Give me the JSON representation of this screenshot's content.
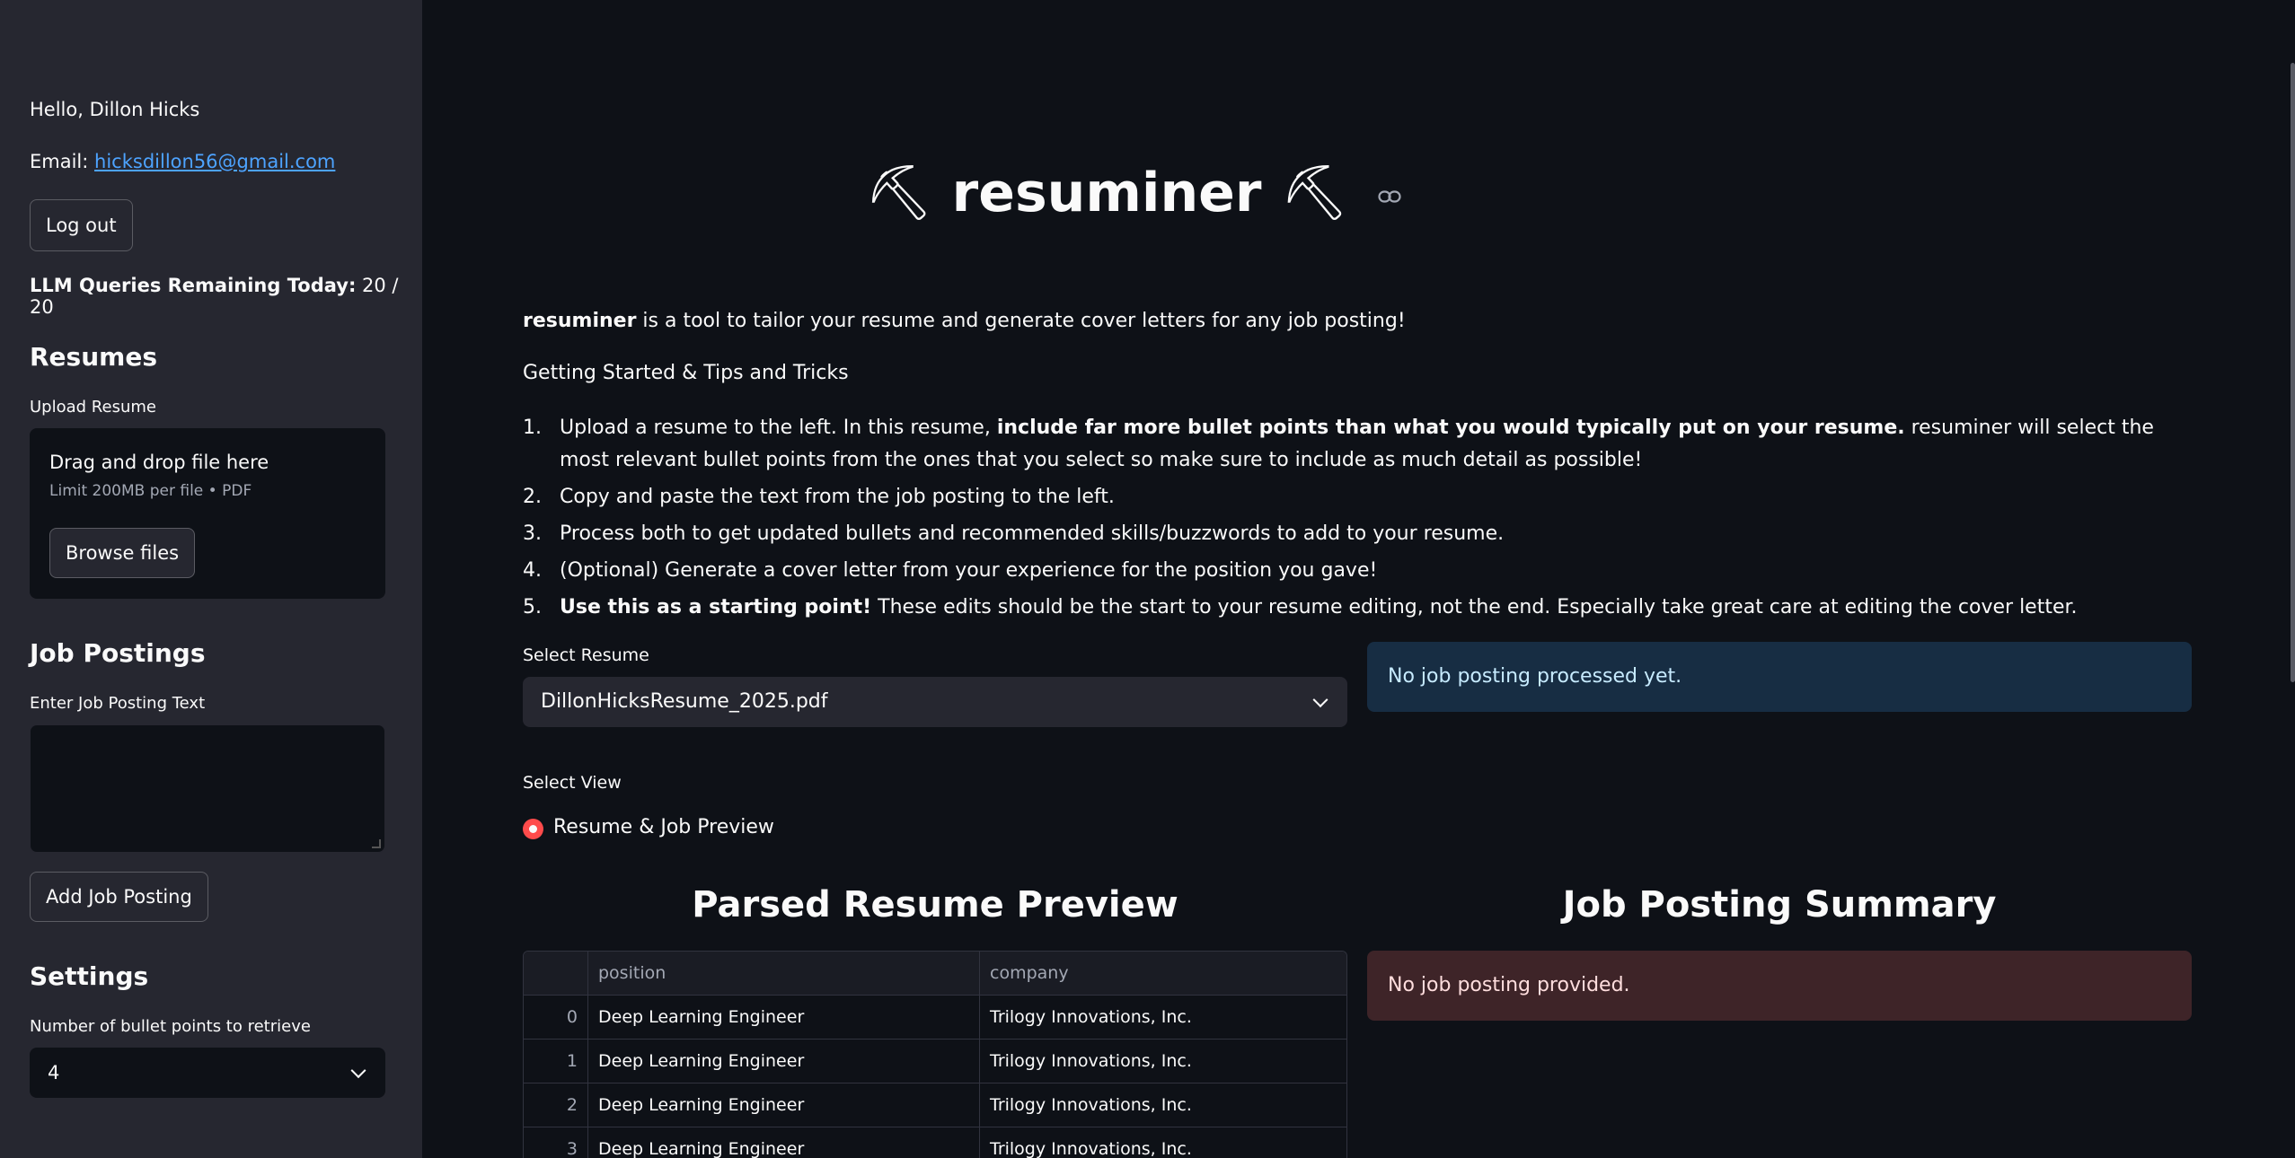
{
  "sidebar": {
    "greeting": "Hello, Dillon Hicks",
    "email_label": "Email:",
    "email_value": "hicksdillon56@gmail.com",
    "logout_label": "Log out",
    "queries_label": "LLM Queries Remaining Today:",
    "queries_value": "20 / 20",
    "resumes_heading": "Resumes",
    "upload_label": "Upload Resume",
    "upload_drop_text": "Drag and drop file here",
    "upload_limit": "Limit 200MB per file • PDF",
    "browse_label": "Browse files",
    "job_postings_heading": "Job Postings",
    "job_text_label": "Enter Job Posting Text",
    "job_text_value": "",
    "add_job_label": "Add Job Posting",
    "settings_heading": "Settings",
    "bullets_label": "Number of bullet points to retrieve",
    "bullets_value": "4"
  },
  "main": {
    "title": "resuminer",
    "title_icon": "⛏",
    "intro_bold": "resuminer",
    "intro_rest": " is a tool to tailor your resume and generate cover letters for any job posting!",
    "getting_started": "Getting Started & Tips and Tricks",
    "steps": [
      {
        "num": "1.",
        "pre": "Upload a resume to the left. In this resume, ",
        "bold": "include far more bullet points than what you would typically put on your resume.",
        "post": " resuminer will select the most relevant bullet points from the ones that you select so make sure to include as much detail as possible!"
      },
      {
        "num": "2.",
        "pre": "Copy and paste the text from the job posting to the left.",
        "bold": "",
        "post": ""
      },
      {
        "num": "3.",
        "pre": "Process both to get updated bullets and recommended skills/buzzwords to add to your resume.",
        "bold": "",
        "post": ""
      },
      {
        "num": "4.",
        "pre": "(Optional) Generate a cover letter from your experience for the position you gave!",
        "bold": "",
        "post": ""
      },
      {
        "num": "5.",
        "pre": "",
        "bold": "Use this as a starting point!",
        "post": " These edits should be the start to your resume editing, not the end. Especially take great care at editing the cover letter."
      }
    ],
    "select_resume_label": "Select Resume",
    "select_resume_value": "DillonHicksResume_2025.pdf",
    "info_message": "No job posting processed yet.",
    "select_view_label": "Select View",
    "view_option": "Resume & Job Preview",
    "resume_preview_heading": "Parsed Resume Preview",
    "job_summary_heading": "Job Posting Summary",
    "job_summary_message": "No job posting provided.",
    "table": {
      "columns": [
        "",
        "position",
        "company"
      ],
      "rows": [
        {
          "index": "0",
          "position": "Deep Learning Engineer",
          "company": "Trilogy Innovations, Inc."
        },
        {
          "index": "1",
          "position": "Deep Learning Engineer",
          "company": "Trilogy Innovations, Inc."
        },
        {
          "index": "2",
          "position": "Deep Learning Engineer",
          "company": "Trilogy Innovations, Inc."
        },
        {
          "index": "3",
          "position": "Deep Learning Engineer",
          "company": "Trilogy Innovations, Inc."
        }
      ]
    }
  },
  "icons": {
    "title_pick": "pick-icon",
    "anchor": "link-icon",
    "dropdown": "chevron-down-icon"
  },
  "colors": {
    "background": "#0e1117",
    "sidebar": "#262730",
    "primary": "#ff4b4b",
    "info_bg": "#172d43",
    "error_bg": "#3e2428",
    "link": "#4da3ff"
  }
}
